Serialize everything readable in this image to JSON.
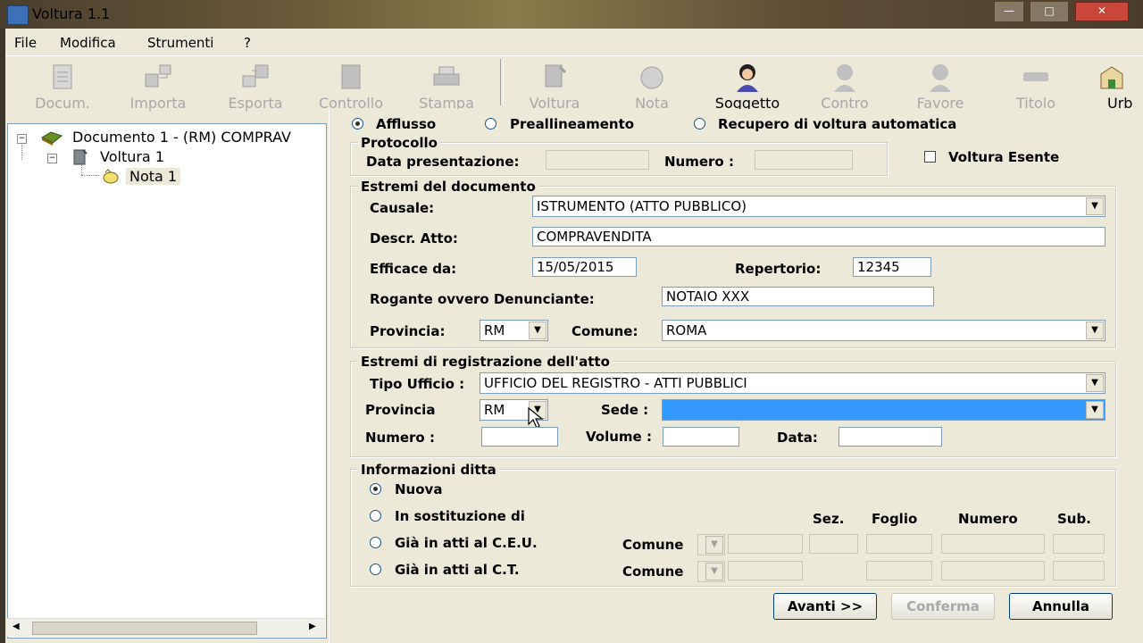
{
  "window": {
    "title": "Voltura 1.1"
  },
  "menu": [
    "File",
    "Modifica",
    "Strumenti",
    "?"
  ],
  "toolbar": [
    {
      "label": "Docum.",
      "icon": "document-icon",
      "enabled": false
    },
    {
      "label": "Importa",
      "icon": "import-icon",
      "enabled": false
    },
    {
      "label": "Esporta",
      "icon": "export-icon",
      "enabled": false
    },
    {
      "label": "Controllo",
      "icon": "check-icon",
      "enabled": false
    },
    {
      "label": "Stampa",
      "icon": "printer-icon",
      "enabled": false
    },
    {
      "label": "Voltura",
      "icon": "voltura-icon",
      "enabled": false
    },
    {
      "label": "Nota",
      "icon": "note-icon",
      "enabled": false
    },
    {
      "label": "Soggetto",
      "icon": "person-icon",
      "enabled": true
    },
    {
      "label": "Contro",
      "icon": "person-against-icon",
      "enabled": false
    },
    {
      "label": "Favore",
      "icon": "person-favor-icon",
      "enabled": false
    },
    {
      "label": "Titolo",
      "icon": "title-icon",
      "enabled": false
    },
    {
      "label": "Urb",
      "icon": "building-icon",
      "enabled": false
    }
  ],
  "tree": {
    "documento": "Documento  1 - (RM) COMPRAV",
    "voltura": "Voltura  1",
    "nota": "Nota  1"
  },
  "form": {
    "type_options": {
      "afflusso": "Afflusso",
      "preallineamento": "Preallineamento",
      "recupero": "Recupero di voltura automatica",
      "selected": "afflusso"
    },
    "protocollo": {
      "title": "Protocollo",
      "data_label": "Data presentazione:",
      "data_value": "",
      "numero_label": "Numero :",
      "numero_value": ""
    },
    "voltura_esente": {
      "label": "Voltura Esente",
      "checked": false
    },
    "estremi_documento": {
      "title": "Estremi del documento",
      "causale_label": "Causale:",
      "causale_value": "ISTRUMENTO (ATTO PUBBLICO)",
      "descr_label": "Descr. Atto:",
      "descr_value": "COMPRAVENDITA",
      "efficace_label": "Efficace da:",
      "efficace_value": "15/05/2015",
      "repertorio_label": "Repertorio:",
      "repertorio_value": "12345",
      "rogante_label": "Rogante ovvero Denunciante:",
      "rogante_value": "NOTAIO XXX",
      "provincia_label": "Provincia:",
      "provincia_value": "RM",
      "comune_label": "Comune:",
      "comune_value": "ROMA"
    },
    "estremi_registrazione": {
      "title": "Estremi di registrazione dell'atto",
      "tipo_label": "Tipo Ufficio :",
      "tipo_value": "UFFICIO DEL REGISTRO - ATTI PUBBLICI",
      "provincia_label": "Provincia",
      "provincia_value": "RM",
      "sede_label": "Sede :",
      "sede_value": "",
      "numero_label": "Numero :",
      "numero_value": "",
      "volume_label": "Volume :",
      "volume_value": "",
      "data_label": "Data:",
      "data_value": ""
    },
    "informazioni_ditta": {
      "title": "Informazioni ditta",
      "nuova": "Nuova",
      "sostituzione": "In sostituzione di",
      "ceu": "Già in atti al C.E.U.",
      "ct": "Già in atti al C.T.",
      "selected": "nuova",
      "col_sez": "Sez.",
      "col_foglio": "Foglio",
      "col_numero": "Numero",
      "col_sub": "Sub.",
      "comune_label": "Comune"
    },
    "buttons": {
      "avanti": "Avanti >>",
      "conferma": "Conferma",
      "annulla": "Annulla"
    }
  },
  "colors": {
    "window_bg": "#ece9d8",
    "selection": "#3399ff",
    "field_border": "#7f9db9"
  }
}
